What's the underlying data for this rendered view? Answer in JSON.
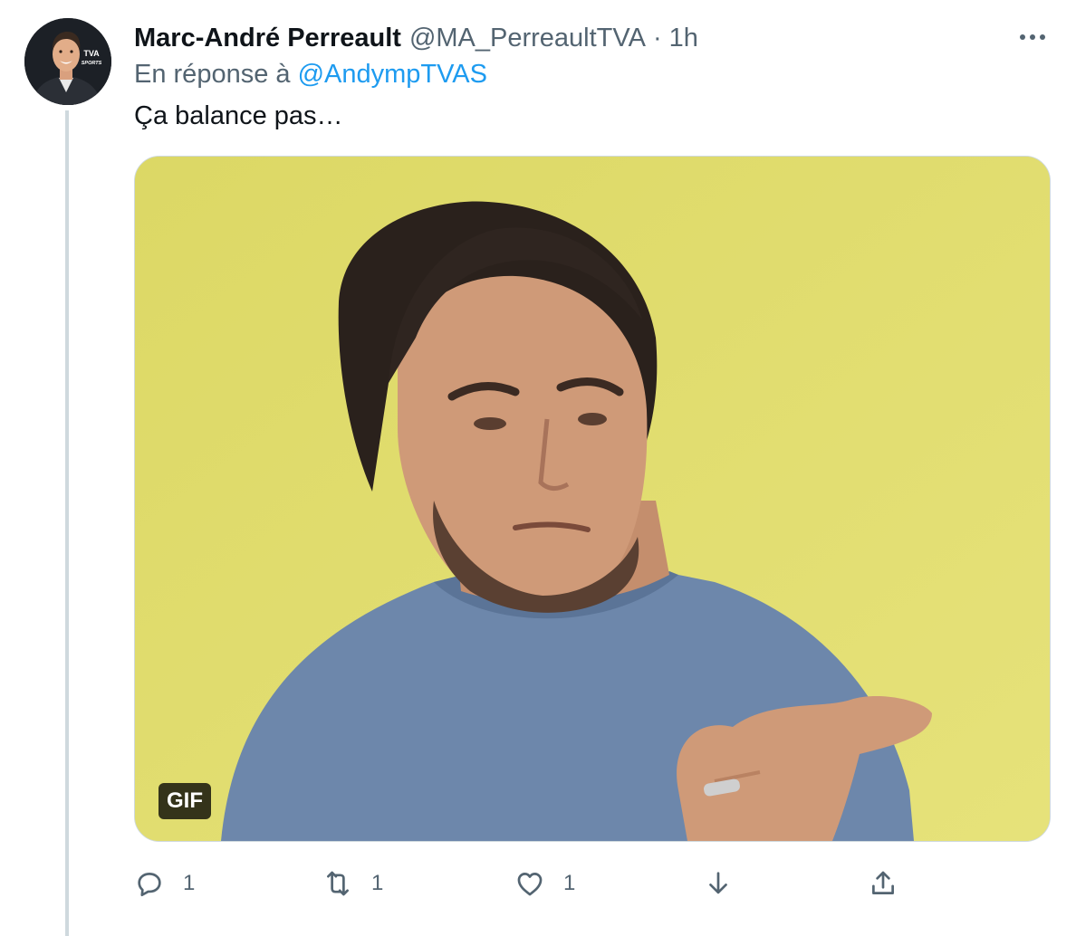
{
  "author": {
    "display_name": "Marc-André Perreault",
    "handle": "@MA_PerreaultTVA",
    "separator": "·",
    "time": "1h",
    "avatar_badge_line1": "TVA",
    "avatar_badge_line2": "SPORTS"
  },
  "reply": {
    "prefix": "En réponse à",
    "mention": "@AndympTVAS"
  },
  "tweet": {
    "text": "Ça balance pas…"
  },
  "media": {
    "type_badge": "GIF",
    "background_color": "#e1dd6a"
  },
  "actions": {
    "reply_count": "1",
    "retweet_count": "1",
    "like_count": "1"
  },
  "colors": {
    "link": "#1d9bf0",
    "secondary_text": "#536471",
    "primary_text": "#0f1419",
    "thread_line": "#cfd9de"
  }
}
